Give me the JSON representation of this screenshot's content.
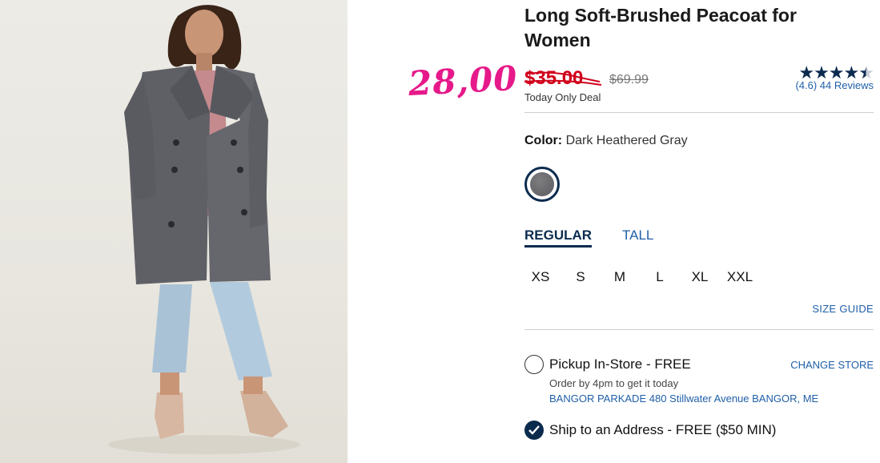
{
  "product": {
    "title": "Long Soft-Brushed Peacoat for Women",
    "photo_alt": "Woman wearing a long gray peacoat with jeans and mules"
  },
  "annotation": {
    "handwritten_price": "28,00",
    "color": "#e6198a"
  },
  "pricing": {
    "sale_price": "$35.00",
    "original_price": "$69.99",
    "deal_label": "Today Only Deal",
    "sale_color": "#d0011b"
  },
  "rating": {
    "value": 4.6,
    "stars_filled": 4.5,
    "rating_text": "(4.6)",
    "reviews_text": "44 Reviews"
  },
  "color": {
    "label": "Color:",
    "value": "Dark Heathered Gray",
    "swatch_hex": "#6a6a6e"
  },
  "fit": {
    "tabs": [
      {
        "label": "REGULAR",
        "active": true
      },
      {
        "label": "TALL",
        "active": false
      }
    ]
  },
  "sizes": [
    "XS",
    "S",
    "M",
    "L",
    "XL",
    "XXL"
  ],
  "size_guide_label": "SIZE GUIDE",
  "fulfillment": {
    "pickup": {
      "label": "Pickup In-Store - FREE",
      "note": "Order by 4pm to get it today",
      "store": "BANGOR PARKADE 480 Stillwater Avenue  BANGOR, ME",
      "change_label": "CHANGE STORE",
      "selected": false
    },
    "ship": {
      "label": "Ship to an Address - FREE ($50 MIN)",
      "selected": true
    }
  },
  "colors": {
    "brand_navy": "#0b2b4e",
    "link_blue": "#1f5fa8"
  }
}
